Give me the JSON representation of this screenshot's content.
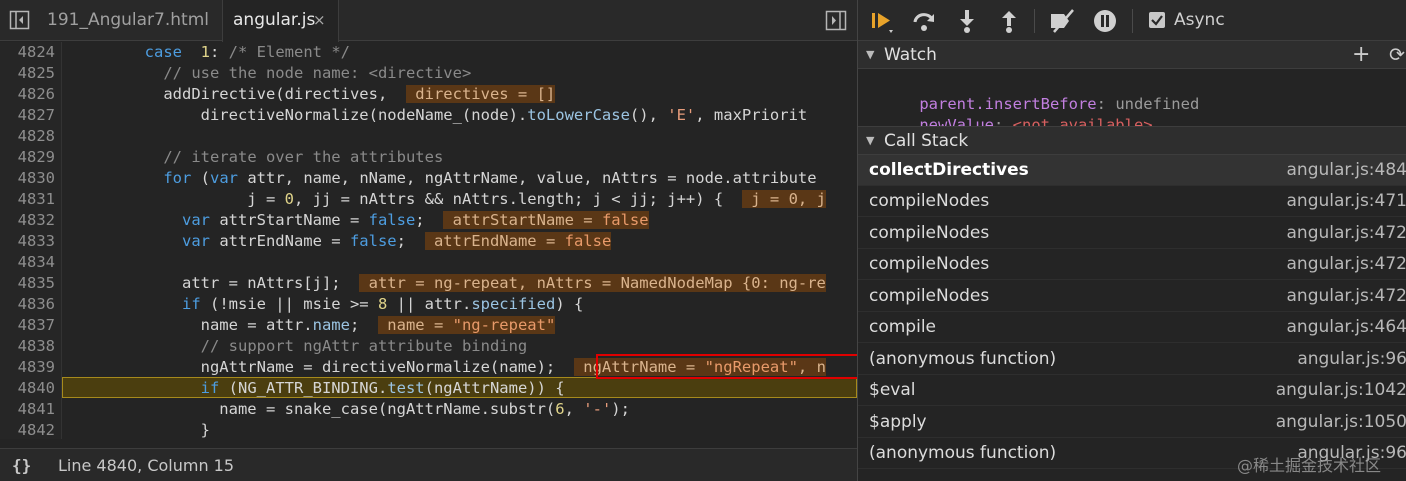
{
  "tabs": [
    {
      "label": "191_Angular7.html"
    },
    {
      "label": "angular.js",
      "close": "×"
    }
  ],
  "code": {
    "line_numbers": [
      "4824",
      "4825",
      "4826",
      "4827",
      "4828",
      "4829",
      "4830",
      "4831",
      "4832",
      "4833",
      "4834",
      "4835",
      "4836",
      "4837",
      "4838",
      "4839",
      "4840",
      "4841",
      "4842"
    ],
    "current_line": "4840"
  },
  "status": {
    "braces": "{}",
    "position": "Line 4840, Column 15"
  },
  "debugger": {
    "async_label": "Async",
    "async_checked": true
  },
  "watch": {
    "title": "Watch",
    "add": "+",
    "refresh": "⟳",
    "items": [
      {
        "name": "parent.insertBefore",
        "value": "undefined"
      },
      {
        "name": "newValue",
        "value": "<not available>"
      }
    ]
  },
  "call_stack": {
    "title": "Call Stack",
    "frames": [
      {
        "fn": "collectDirectives",
        "loc": "angular.js:484"
      },
      {
        "fn": "compileNodes",
        "loc": "angular.js:471"
      },
      {
        "fn": "compileNodes",
        "loc": "angular.js:472"
      },
      {
        "fn": "compileNodes",
        "loc": "angular.js:472"
      },
      {
        "fn": "compileNodes",
        "loc": "angular.js:472"
      },
      {
        "fn": "compile",
        "loc": "angular.js:464"
      },
      {
        "fn": "(anonymous function)",
        "loc": "angular.js:96"
      },
      {
        "fn": "$eval",
        "loc": "angular.js:1042"
      },
      {
        "fn": "$apply",
        "loc": "angular.js:1050"
      },
      {
        "fn": "(anonymous function)",
        "loc": "angular.js:96"
      }
    ]
  },
  "watermark": "@稀土掘金技术社区"
}
